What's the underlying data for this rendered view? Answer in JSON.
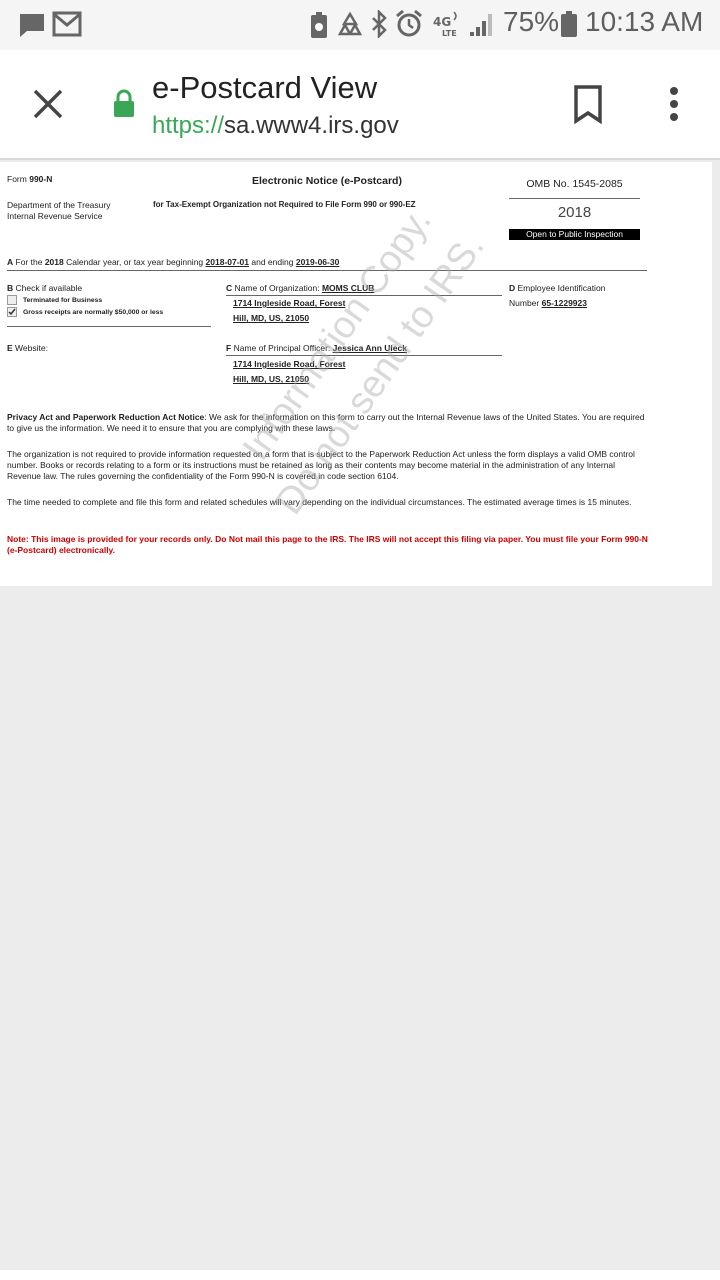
{
  "status_bar": {
    "battery_percent": "75%",
    "time": "10:13 AM",
    "network": "4G LTE",
    "icons": [
      "message-icon",
      "gmail-icon",
      "battery-saver-icon",
      "recycle-icon",
      "bluetooth-icon",
      "alarm-icon",
      "4g-lte-icon",
      "signal-icon",
      "battery-icon"
    ]
  },
  "toolbar": {
    "title": "e-Postcard View",
    "url_scheme": "https://",
    "url_host": "sa.www4.irs.gov",
    "icons": [
      "close-icon",
      "lock-icon",
      "bookmark-icon",
      "more-vert-icon"
    ],
    "lock_color": "#3aa757"
  },
  "form": {
    "form_label": "Form",
    "form_number": "990-N",
    "title": "Electronic Notice (e-Postcard)",
    "subtitle": "for Tax-Exempt Organization not Required to File Form 990 or 990-EZ",
    "dept_line1": "Department of the Treasury",
    "dept_line2": "Internal Revenue Service",
    "omb": "OMB No. 1545-2085",
    "year": "2018",
    "public_inspection": "Open to Public Inspection",
    "line_a_prefix": "A",
    "line_a_for_the": "For the",
    "line_a_year": "2018",
    "line_a_middle": "Calendar year, or tax year beginning",
    "line_a_begin": "2018-07-01",
    "line_a_and_ending": "and ending",
    "line_a_end": "2019-06-30",
    "b_letter": "B",
    "b_label": "Check if available",
    "b_option1": "Terminated for Business",
    "b_option2": "Gross receipts are normally $50,000 or less",
    "b_option2_checked": true,
    "c_letter": "C",
    "c_label": "Name of Organization:",
    "c_name": "MOMS CLUB",
    "c_addr1": "1714 Ingleside Road, Forest",
    "c_addr2": "Hill, MD, US, 21050",
    "d_letter": "D",
    "d_label1": "Employee Identification",
    "d_label2": "Number",
    "d_ein": "65-1229923",
    "e_letter": "E",
    "e_label": "Website:",
    "f_letter": "F",
    "f_label": "Name of Principal Officer:",
    "f_name": "Jessica Ann Uleck",
    "f_addr1": "1714 Ingleside Road, Forest",
    "f_addr2": "Hill, MD, US, 21050",
    "privacy_heading": "Privacy Act and Paperwork Reduction Act Notice",
    "privacy_text": ": We ask for the information on this form to carry out the Internal Revenue laws of the United States. You are required to give us the information. We need it to ensure that you are complying with these laws.",
    "para2": "The organization is not required to provide information requested on a form that is subject to the Paperwork Reduction Act unless the form displays a valid OMB control number. Books or records relating to a form or its instructions must be retained as long as their contents may become material in the administration of any Internal Revenue law. The rules governing the confidentiality of the Form 990-N is covered in code section 6104.",
    "para3": "The time needed to complete and file this form and related schedules will vary depending on the individual circumstances. The estimated average times is 15 minutes.",
    "note": "Note: This image is provided for your records only. Do Not mail this page to the IRS. The IRS will not accept this filing via paper. You must file your Form 990-N (e-Postcard) electronically.",
    "watermark1": "Information Copy.",
    "watermark2": "Do not send to IRS."
  }
}
